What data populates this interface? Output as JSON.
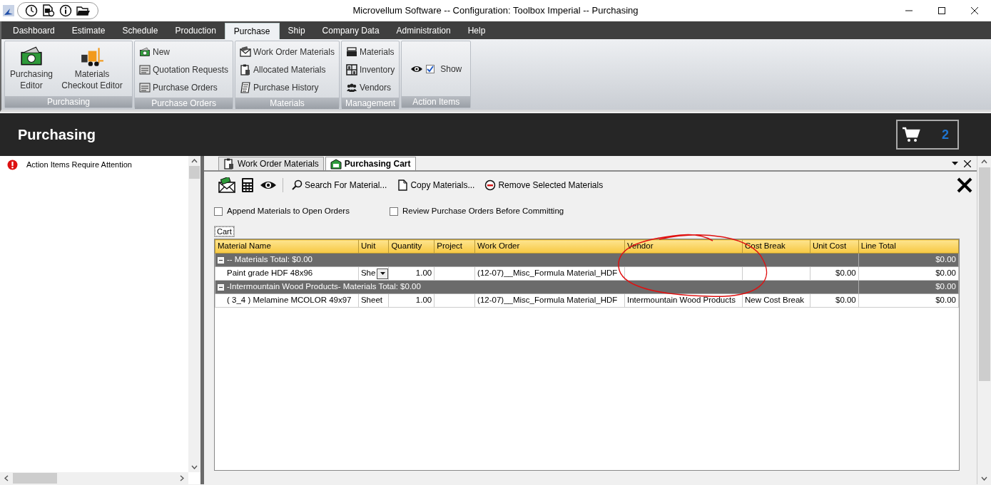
{
  "window": {
    "title": "Microvellum Software -- Configuration: Toolbox Imperial -- Purchasing"
  },
  "menu_tabs": [
    {
      "label": "Dashboard",
      "selected": false
    },
    {
      "label": "Estimate",
      "selected": false
    },
    {
      "label": "Schedule",
      "selected": false
    },
    {
      "label": "Production",
      "selected": false
    },
    {
      "label": "Purchase",
      "selected": true
    },
    {
      "label": "Ship",
      "selected": false
    },
    {
      "label": "Company Data",
      "selected": false
    },
    {
      "label": "Administration",
      "selected": false
    },
    {
      "label": "Help",
      "selected": false
    }
  ],
  "ribbon_groups": [
    {
      "caption": "Purchasing",
      "items": [
        {
          "kind": "large",
          "label": "Purchasing Editor"
        },
        {
          "kind": "large",
          "label": "Materials Checkout Editor"
        }
      ]
    },
    {
      "caption": "Purchase Orders",
      "items": [
        {
          "kind": "small",
          "label": "New"
        },
        {
          "kind": "small",
          "label": "Quotation Requests"
        },
        {
          "kind": "small",
          "label": "Purchase Orders"
        }
      ]
    },
    {
      "caption": "Materials",
      "items": [
        {
          "kind": "small",
          "label": "Work Order Materials"
        },
        {
          "kind": "small",
          "label": "Allocated Materials"
        },
        {
          "kind": "small",
          "label": "Purchase History"
        }
      ]
    },
    {
      "caption": "Management",
      "items": [
        {
          "kind": "small",
          "label": "Materials"
        },
        {
          "kind": "small",
          "label": "Inventory"
        },
        {
          "kind": "small",
          "label": "Vendors"
        }
      ]
    },
    {
      "caption": "Action Items",
      "items": [
        {
          "kind": "check",
          "label": "Show",
          "checked": true
        }
      ]
    }
  ],
  "header": {
    "title": "Purchasing",
    "cart_count": "2"
  },
  "action_items": [
    {
      "label": "Action Items Require Attention"
    }
  ],
  "document_tabs": [
    {
      "label": "Work Order Materials",
      "selected": false
    },
    {
      "label": "Purchasing Cart",
      "selected": true
    }
  ],
  "toolbar": [
    {
      "label": "Search For Material..."
    },
    {
      "label": "Copy Materials..."
    },
    {
      "label": "Remove Selected Materials"
    }
  ],
  "options": [
    {
      "label": "Append Materials to Open Orders",
      "checked": false
    },
    {
      "label": "Review Purchase Orders Before Committing",
      "checked": false
    }
  ],
  "grid_tab": {
    "label": "Cart"
  },
  "grid": {
    "columns": [
      "Material Name",
      "Unit",
      "Quantity",
      "Project",
      "Work Order",
      "Vendor",
      "Cost Break",
      "Unit Cost",
      "Line Total"
    ],
    "groups": [
      {
        "label": "-- Materials Total: $0.00",
        "total": "$0.00",
        "expanded": true,
        "rows": [
          {
            "material_name": "Paint grade HDF 48x96",
            "unit": "She",
            "unit_dropdown": true,
            "quantity": "1.00",
            "work_order": "(12-07)__Misc_Formula Material_HDF",
            "unit_cost": "$0.00",
            "line_total": "$0.00"
          }
        ]
      },
      {
        "label": "-Intermountain Wood Products- Materials Total: $0.00",
        "total": "$0.00",
        "expanded": true,
        "rows": [
          {
            "material_name": "( 3_4 ) Melamine MCOLOR 49x97",
            "unit": "Sheet",
            "unit_dropdown": false,
            "quantity": "1.00",
            "work_order": "(12-07)__Misc_Formula Material_HDF",
            "vendor": "Intermountain Wood Products",
            "cost_break": "New Cost Break",
            "unit_cost": "$0.00",
            "line_total": "$0.00"
          }
        ]
      }
    ]
  }
}
